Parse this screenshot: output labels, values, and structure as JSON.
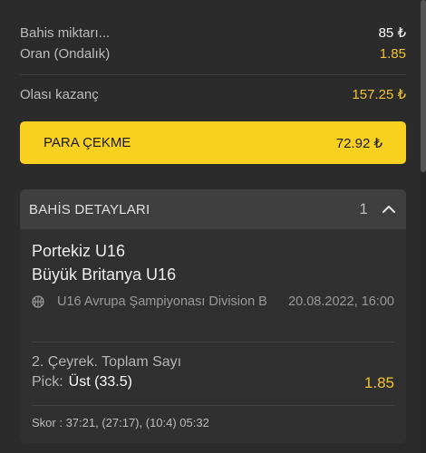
{
  "summary": {
    "stake_label": "Bahis miktarı...",
    "stake_value": "85 ₺",
    "odds_label": "Oran (Ondalık)",
    "odds_value": "1.85",
    "potential_label": "Olası kazanç",
    "potential_value": "157.25 ₺"
  },
  "cashout": {
    "label": "PARA ÇEKME",
    "amount": "72.92 ₺"
  },
  "details": {
    "title": "BAHİS DETAYLARI",
    "count": "1",
    "home_team": "Portekiz U16",
    "away_team": "Büyük Britanya U16",
    "league": "U16 Avrupa Şampiyonası Division B",
    "datetime": "20.08.2022, 16:00",
    "market": "2. Çeyrek. Toplam Sayı",
    "pick_label": "Pick:",
    "pick_value": "Üst (33.5)",
    "pick_odds": "1.85",
    "score": "Skor : 37:21, (27:17), (10:4) 05:32"
  },
  "colors": {
    "accent": "#f7d020",
    "odds": "#f2c230",
    "background": "#2b2b2b"
  },
  "icons": {
    "sport": "basketball-icon",
    "collapse": "chevron-up-icon"
  }
}
